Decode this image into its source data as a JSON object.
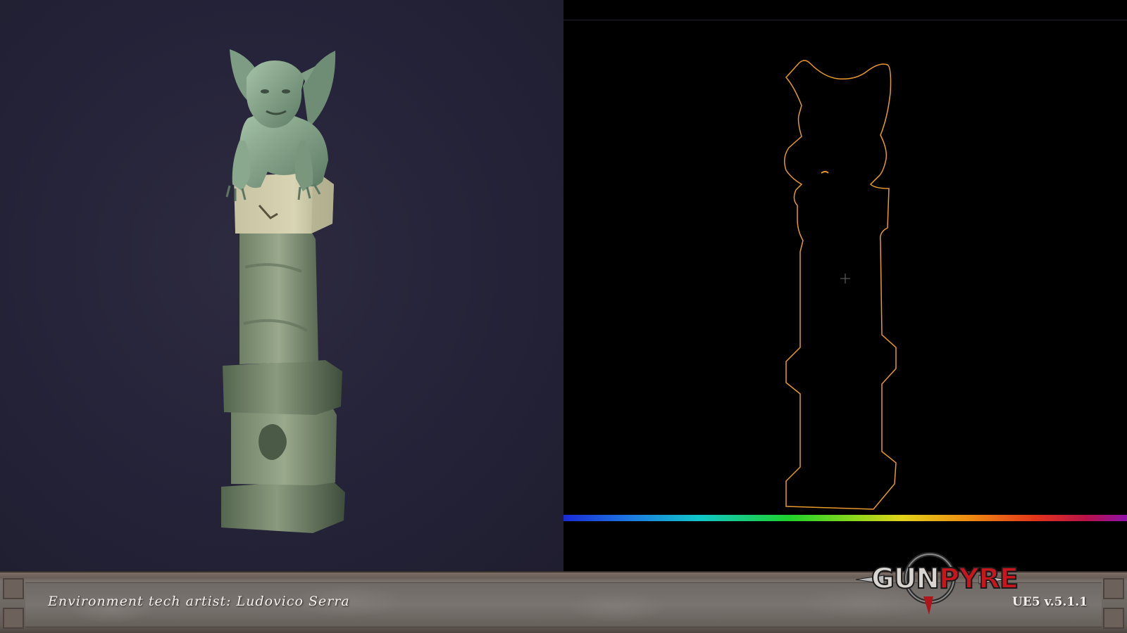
{
  "footer": {
    "credit": "Environment tech artist: Ludovico Serra",
    "version": "UE5 v.5.1.1"
  },
  "logo": {
    "part1": "GUN",
    "part2": "PYRE"
  },
  "colors": {
    "left_background": "#26243a",
    "outline": "#e89a2a",
    "logo_red": "#c8161e"
  },
  "icons": {
    "crosshair": "crosshair-icon"
  }
}
